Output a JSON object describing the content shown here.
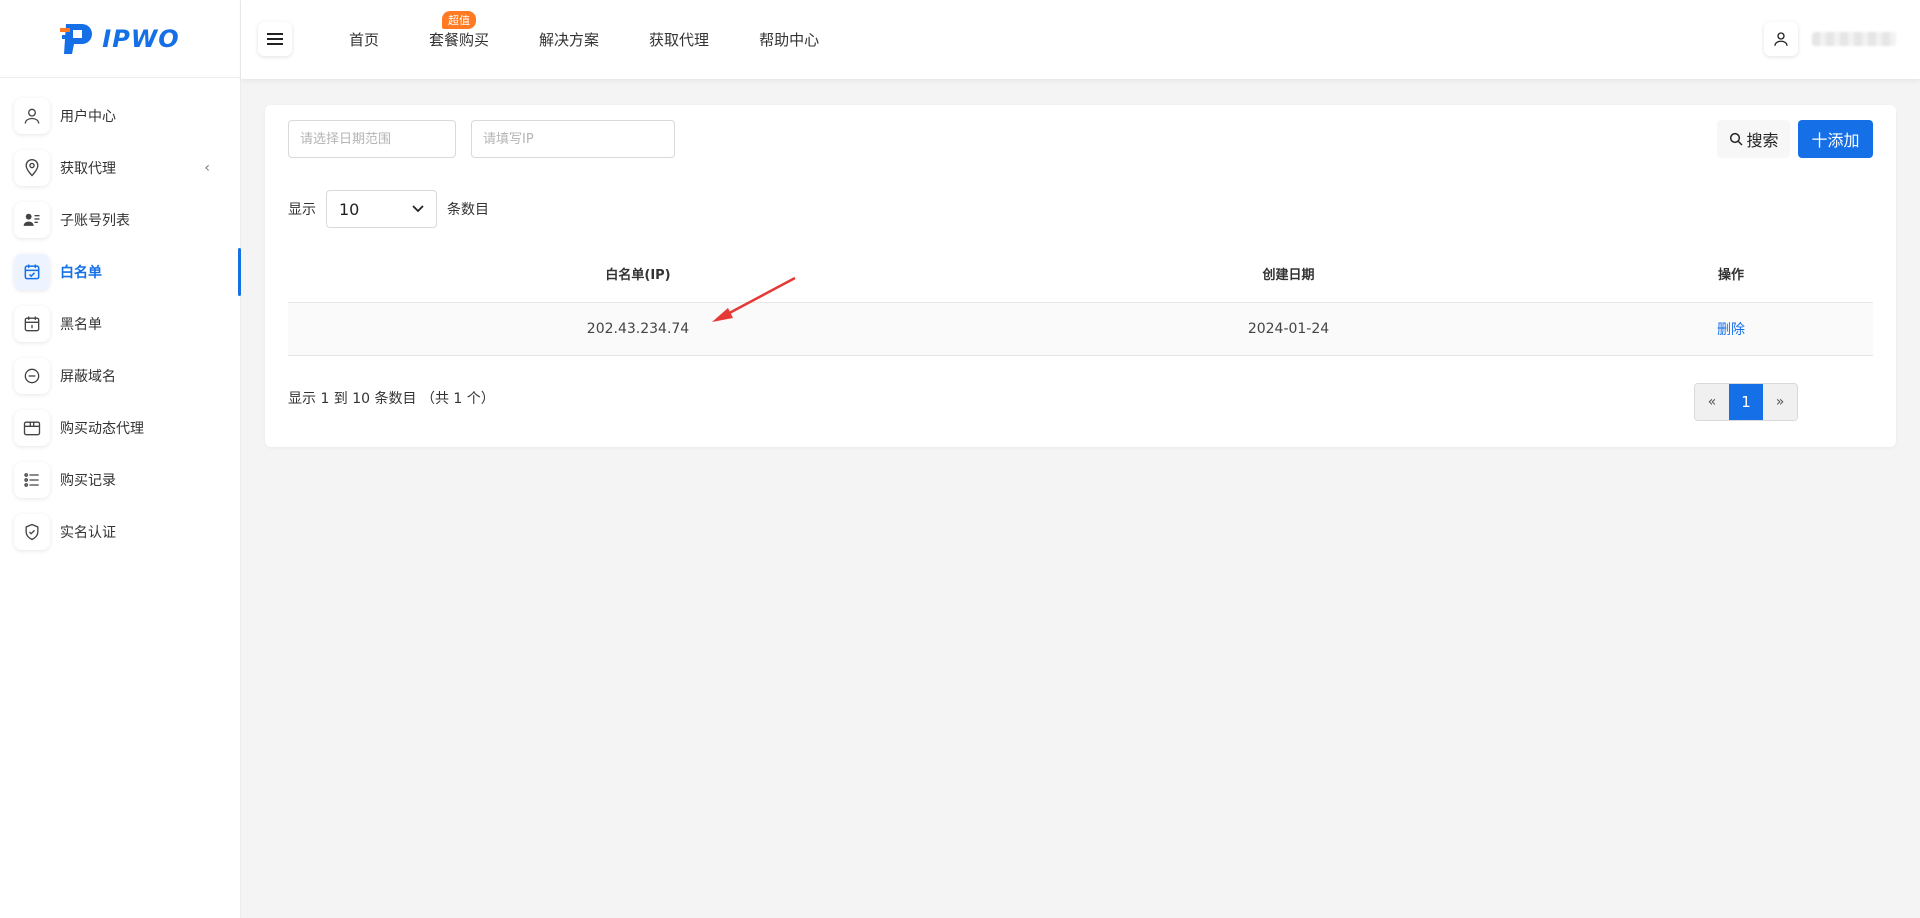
{
  "brand": {
    "name": "IPWO",
    "color": "#1570e8"
  },
  "sidebar": {
    "items": [
      {
        "label": "用户中心",
        "icon": "user-icon"
      },
      {
        "label": "获取代理",
        "icon": "location-pin-icon",
        "has_chevron": true
      },
      {
        "label": "子账号列表",
        "icon": "user-list-icon"
      },
      {
        "label": "白名单",
        "icon": "calendar-check-icon",
        "active": true
      },
      {
        "label": "黑名单",
        "icon": "calendar-icon"
      },
      {
        "label": "屏蔽域名",
        "icon": "minus-circle-icon"
      },
      {
        "label": "购买动态代理",
        "icon": "box-icon"
      },
      {
        "label": "购买记录",
        "icon": "list-icon"
      },
      {
        "label": "实名认证",
        "icon": "shield-check-icon"
      }
    ]
  },
  "header": {
    "nav": [
      {
        "label": "首页"
      },
      {
        "label": "套餐购买",
        "badge": "超值"
      },
      {
        "label": "解决方案"
      },
      {
        "label": "获取代理"
      },
      {
        "label": "帮助中心"
      }
    ]
  },
  "filters": {
    "date_placeholder": "请选择日期范围",
    "ip_placeholder": "请填写IP",
    "search_label": "搜索",
    "add_label": "十添加"
  },
  "page_size": {
    "prefix": "显示",
    "value": "10",
    "suffix": "条数目"
  },
  "table": {
    "headers": [
      "白名单(IP)",
      "创建日期",
      "操作"
    ],
    "rows": [
      {
        "ip": "202.43.234.74",
        "date": "2024-01-24",
        "action": "删除"
      }
    ]
  },
  "footer": {
    "info": "显示 1 到 10 条数目 （共 1 个）",
    "prev": "«",
    "current": "1",
    "next": "»"
  },
  "colors": {
    "accent": "#1570e8",
    "badge": "#ff7a22",
    "annotation_arrow": "#e53935"
  }
}
